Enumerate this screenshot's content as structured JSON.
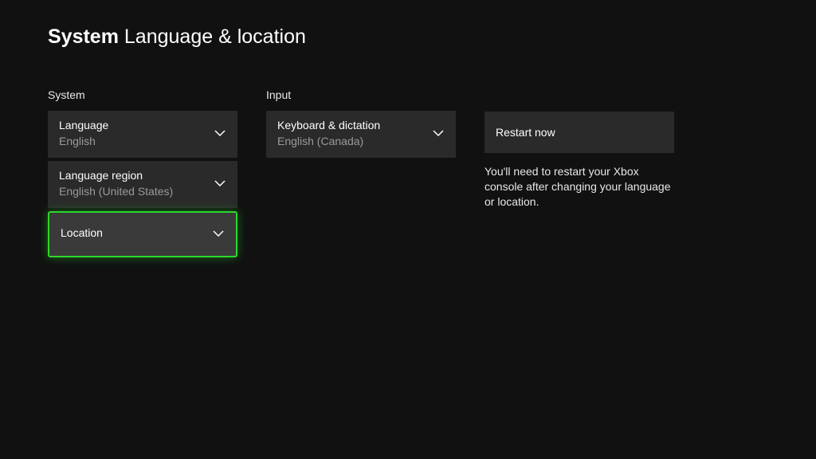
{
  "header": {
    "category": "System",
    "page": "Language & location"
  },
  "columns": {
    "system": {
      "heading": "System",
      "language": {
        "label": "Language",
        "value": "English"
      },
      "region": {
        "label": "Language region",
        "value": "English (United States)"
      },
      "location": {
        "label": "Location",
        "value": ""
      }
    },
    "input": {
      "heading": "Input",
      "keyboard": {
        "label": "Keyboard & dictation",
        "value": "English (Canada)"
      }
    },
    "restart": {
      "button_label": "Restart now",
      "info": "You'll need to restart your Xbox console after changing your language or location."
    }
  }
}
